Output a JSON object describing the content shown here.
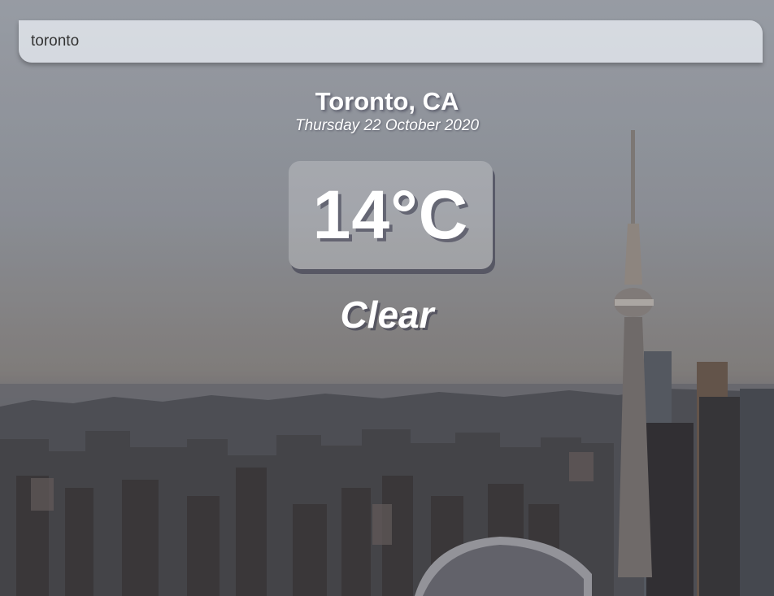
{
  "search": {
    "value": "toronto"
  },
  "location": {
    "city_country": "Toronto, CA",
    "date": "Thursday 22 October 2020"
  },
  "weather": {
    "temperature": "14°C",
    "condition": "Clear"
  },
  "colors": {
    "sky_top": "#a7acb4",
    "sky_horizon": "#8d8984",
    "city": "#3b3a3c",
    "text": "#ffffff"
  }
}
